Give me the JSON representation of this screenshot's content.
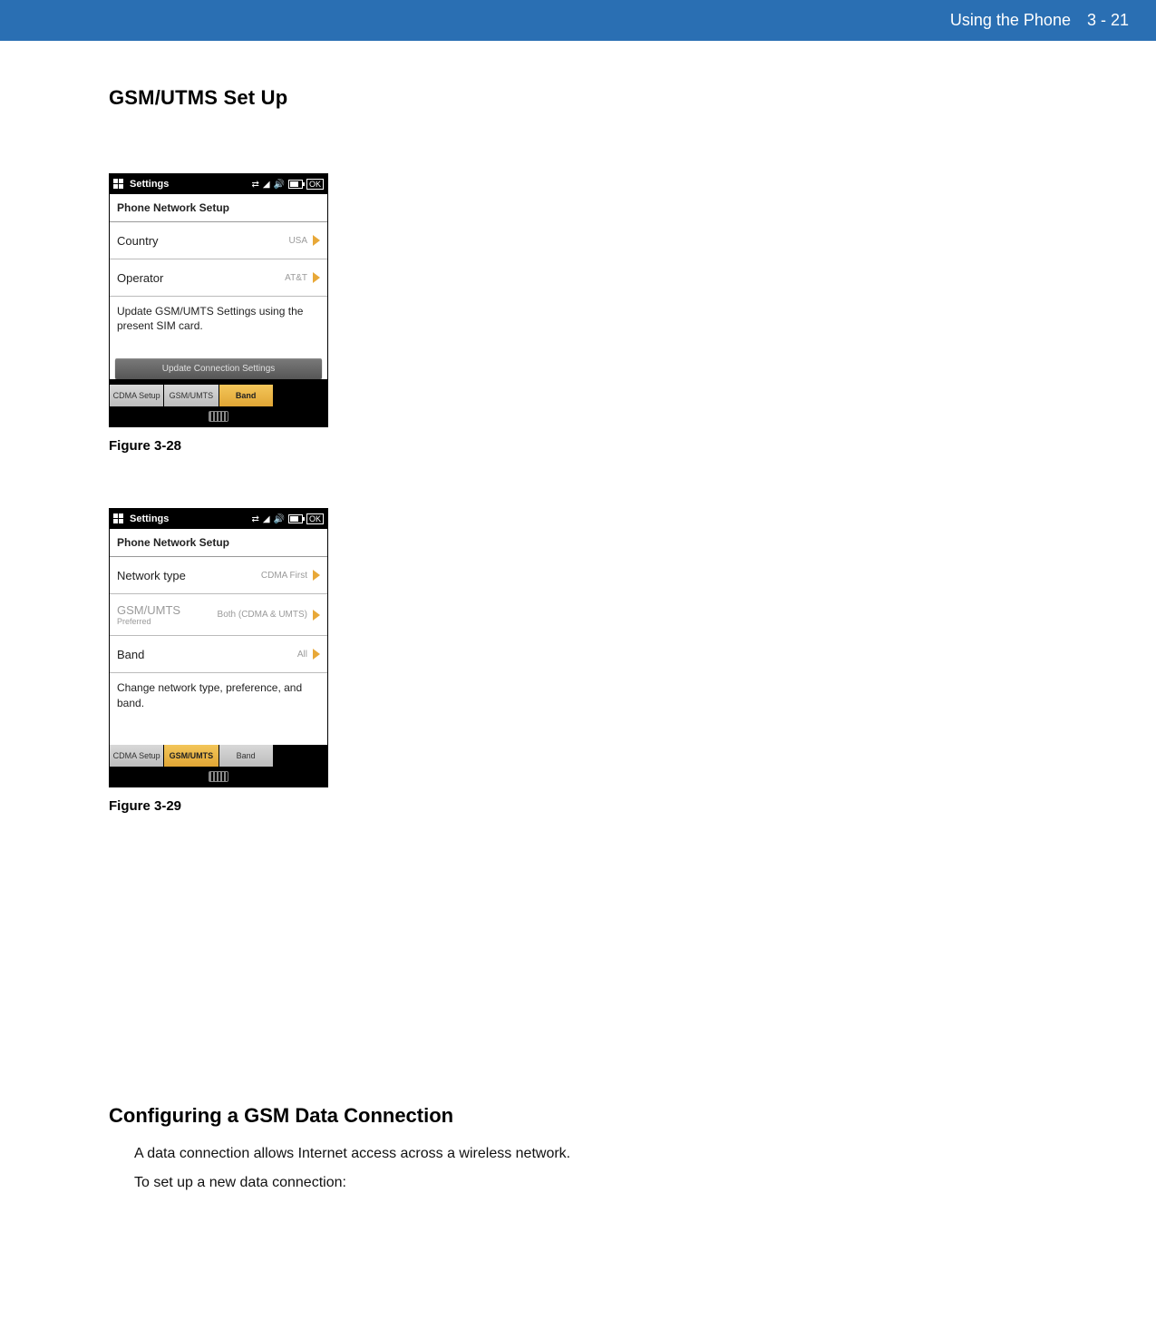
{
  "header": {
    "section": "Using the Phone",
    "page": "3 - 21"
  },
  "title": "GSM/UTMS Set Up",
  "phone_common": {
    "status_title": "Settings",
    "ok": "OK",
    "subtitle": "Phone Network Setup"
  },
  "fig1": {
    "caption": "Figure 3-28",
    "rows": {
      "country": {
        "label": "Country",
        "value": "USA"
      },
      "operator": {
        "label": "Operator",
        "value": "AT&T"
      }
    },
    "desc": "Update GSM/UMTS Settings using the present SIM card.",
    "button": "Update Connection Settings",
    "tabs": {
      "t1": "CDMA Setup",
      "t2": "GSM/UMTS",
      "t3": "Band",
      "active": "t3"
    }
  },
  "fig2": {
    "caption": "Figure 3-29",
    "rows": {
      "nettype": {
        "label": "Network type",
        "value": "CDMA First"
      },
      "pref": {
        "label": "GSM/UMTS",
        "sublabel": "Preferred",
        "value": "Both (CDMA & UMTS)"
      },
      "band": {
        "label": "Band",
        "value": "All"
      }
    },
    "desc": "Change network type, preference, and band.",
    "tabs": {
      "t1": "CDMA Setup",
      "t2": "GSM/UMTS",
      "t3": "Band",
      "active": "t2"
    }
  },
  "section2": {
    "heading": "Configuring a GSM Data Connection",
    "p1": "A data connection allows Internet access across a wireless network.",
    "p2": "To set up a new data connection:"
  }
}
